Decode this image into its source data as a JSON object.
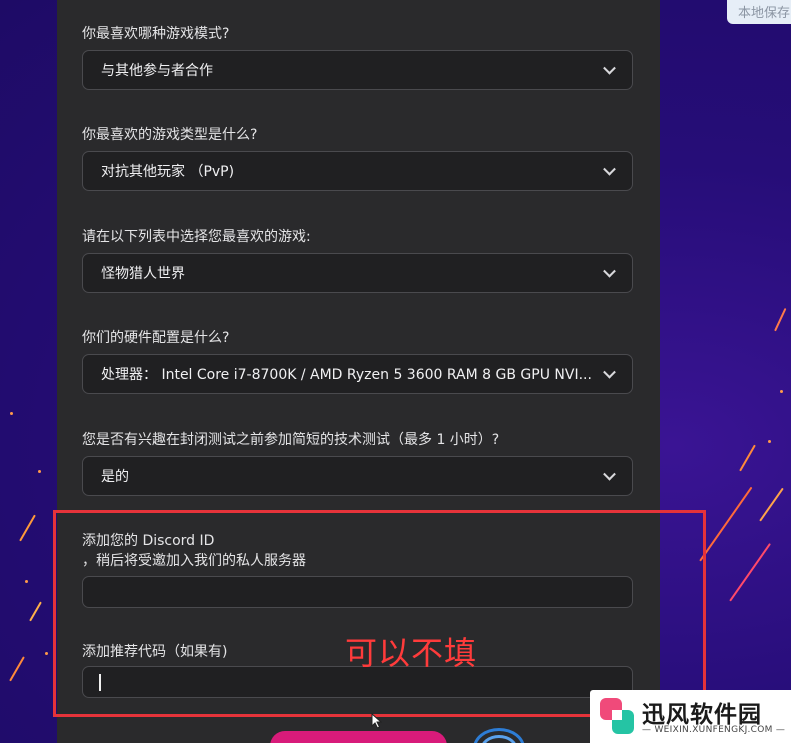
{
  "page": {
    "save_tag": "本地保存"
  },
  "form": {
    "q1": {
      "label": "你最喜欢哪种游戏模式?",
      "value": "与其他参与者合作"
    },
    "q2": {
      "label": "你最喜欢的游戏类型是什么?",
      "value": "对抗其他玩家 （PvP)"
    },
    "q3": {
      "label": "请在以下列表中选择您最喜欢的游戏:",
      "value": "怪物猎人世界"
    },
    "q4": {
      "label": "你们的硬件配置是什么?",
      "value": "处理器： Intel Core i7-8700K / AMD Ryzen 5 3600 RAM 8 GB GPU NVI..."
    },
    "q5": {
      "label": "您是否有兴趣在封闭测试之前参加简短的技术测试（最多 1 小时）?",
      "value": "是的"
    },
    "discord": {
      "label_line1": "添加您的 Discord ID",
      "label_line2": "，稍后将受邀加入我们的私人服务器",
      "value": ""
    },
    "referral": {
      "label": "添加推荐代码（如果有)",
      "value": ""
    }
  },
  "annotation": {
    "text": "可以不填",
    "color": "#ff3b3b"
  },
  "watermark": {
    "title": "迅风软件园",
    "subtitle": "— WEIXIN.XUNFENGKJ.COM —"
  },
  "colors": {
    "panel": "#2a2a2c",
    "field_bg": "#202022",
    "highlight": "#e5333a",
    "submit": "#d81b7a"
  }
}
